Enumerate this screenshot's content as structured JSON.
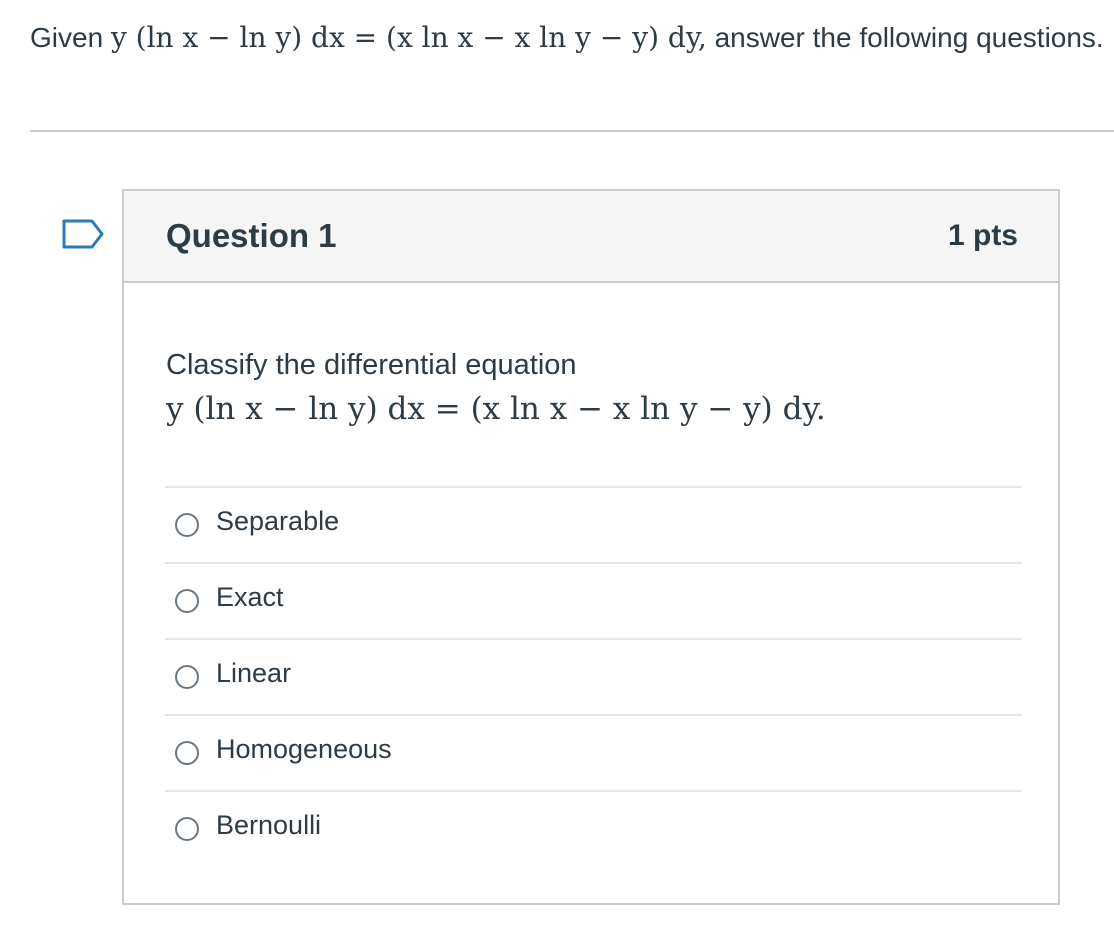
{
  "intro": {
    "prefix": "Given",
    "equation": "y (ln x − ln y) dx = (x ln x − x ln y − y) dy,",
    "suffix": "answer the following questions."
  },
  "question": {
    "title": "Question 1",
    "points": "1 pts",
    "text": "Classify the differential equation",
    "equation": "y (ln x − ln y) dx = (x ln x − x ln y − y) dy.",
    "answers": [
      {
        "label": "Separable",
        "selected": false
      },
      {
        "label": "Exact",
        "selected": false
      },
      {
        "label": "Linear",
        "selected": false
      },
      {
        "label": "Homogeneous",
        "selected": false
      },
      {
        "label": "Bernoulli",
        "selected": false
      }
    ]
  },
  "colors": {
    "text": "#2d3b45",
    "border": "#c7cdd1",
    "header_bg": "#f5f5f5",
    "flag": "#2a7bb8"
  },
  "icons": {
    "flag": "bookmark-flag-icon",
    "radio": "radio-button-icon"
  }
}
